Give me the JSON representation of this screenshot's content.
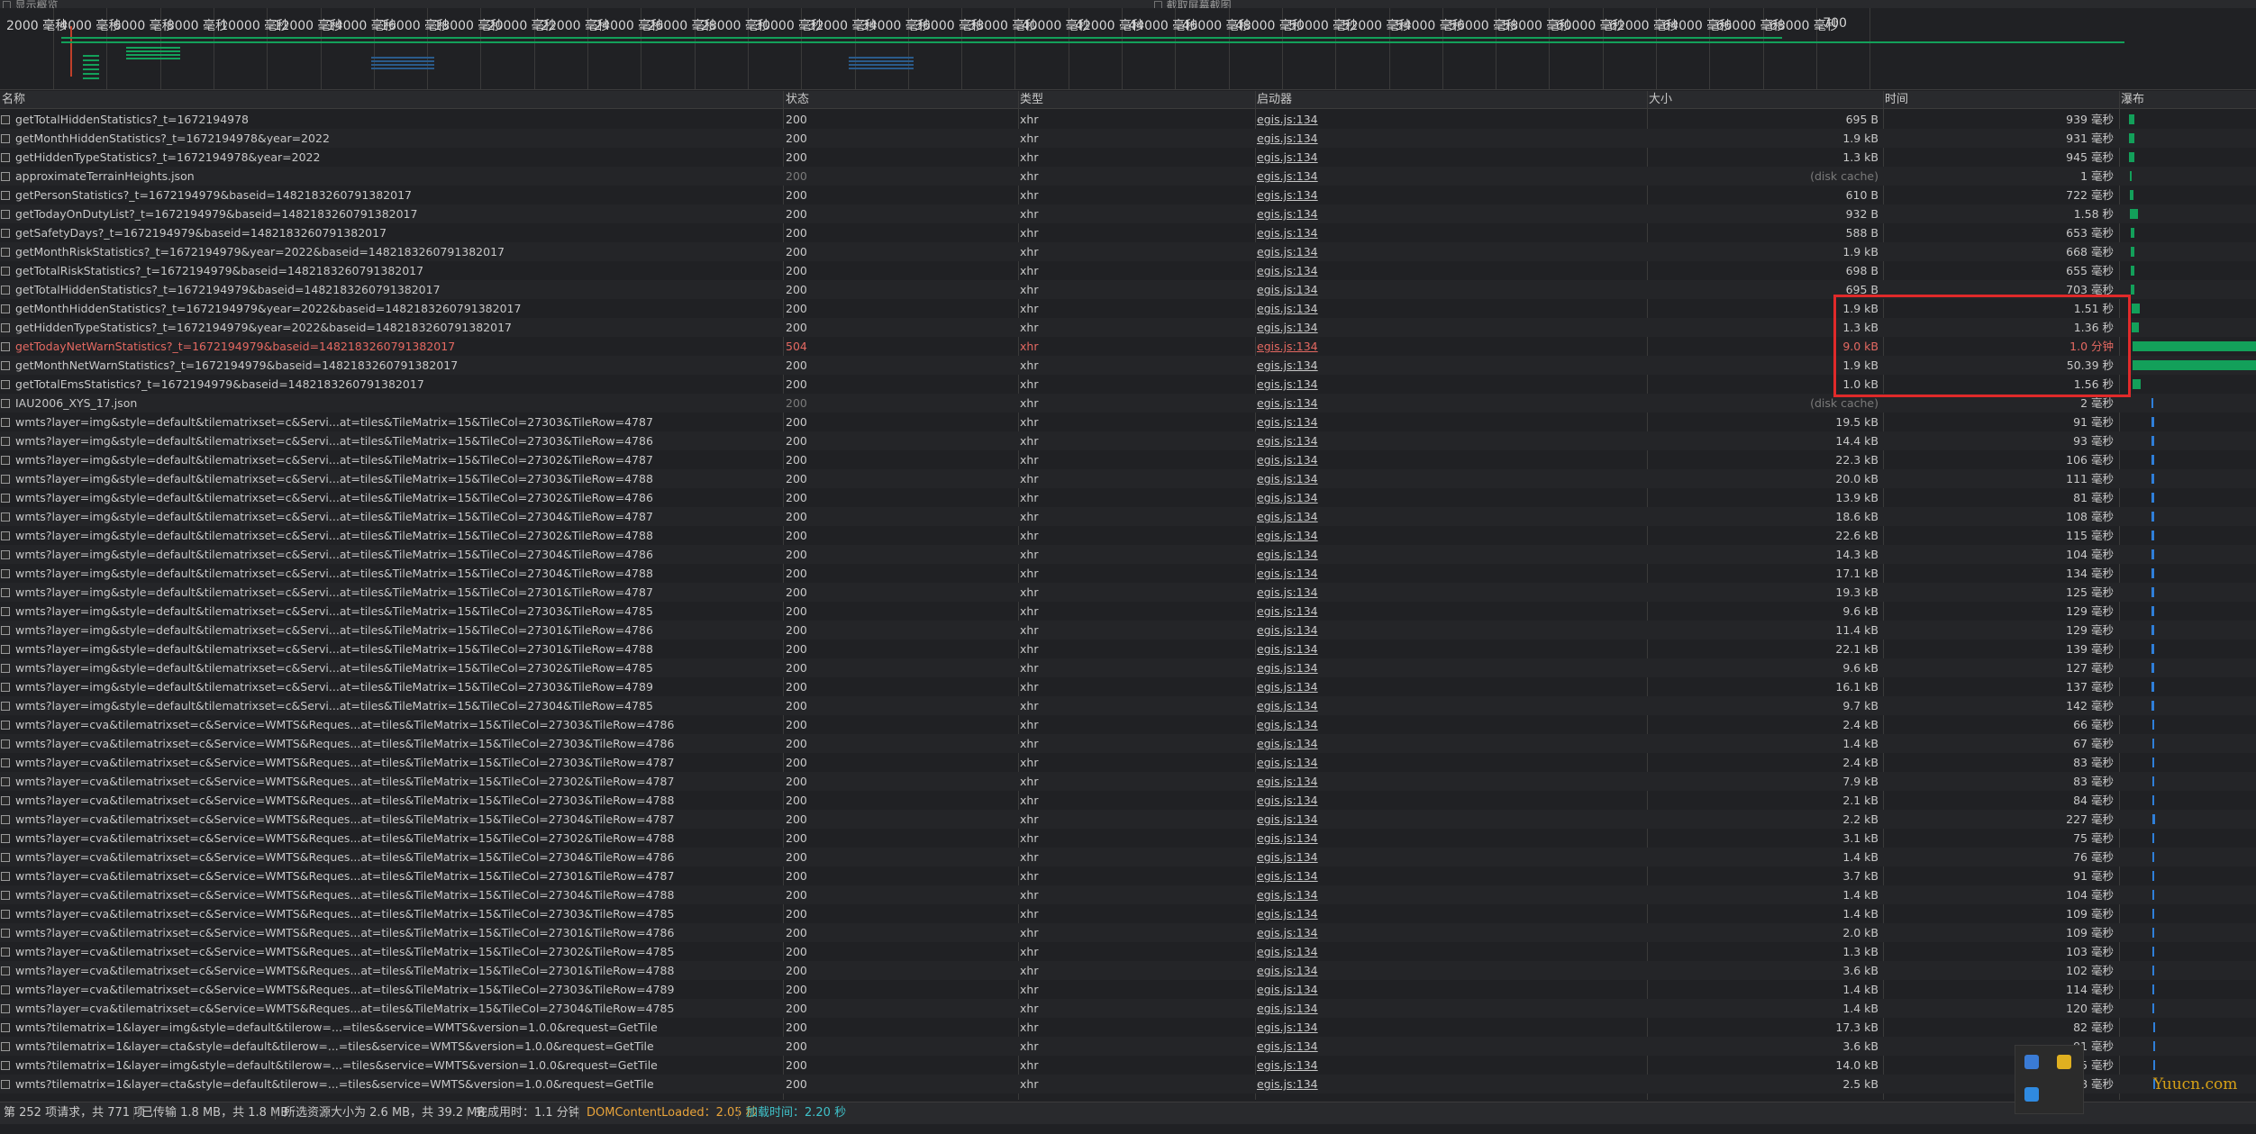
{
  "top": {
    "left_checkbox": "显示概览",
    "right_checkbox": "截取屏幕截图"
  },
  "overview": {
    "ticks": [
      "2000 毫秒",
      "4000 毫秒",
      "6000 毫秒",
      "8000 毫秒",
      "10000 毫秒",
      "12000 毫秒",
      "14000 毫秒",
      "16000 毫秒",
      "18000 毫秒",
      "20000 毫秒",
      "22000 毫秒",
      "24000 毫秒",
      "26000 毫秒",
      "28000 毫秒",
      "30000 毫秒",
      "32000 毫秒",
      "34000 毫秒",
      "36000 毫秒",
      "38000 毫秒",
      "40000 毫秒",
      "42000 毫秒",
      "44000 毫秒",
      "46000 毫秒",
      "48000 毫秒",
      "50000 毫秒",
      "52000 毫秒",
      "54000 毫秒",
      "56000 毫秒",
      "58000 毫秒",
      "60000 毫秒",
      "62000 毫秒",
      "64000 毫秒",
      "66000 毫秒",
      "68000 毫秒",
      "700"
    ]
  },
  "columns": {
    "name": "名称",
    "status": "状态",
    "type": "类型",
    "initiator": "启动器",
    "size": "大小",
    "time": "时间",
    "waterfall": "瀑布"
  },
  "rows": [
    {
      "name": "getTotalHiddenStatistics?_t=1672194978",
      "status": "200",
      "type": "xhr",
      "initiator": "egis.js:134",
      "size": "695 B",
      "time": "939 毫秒"
    },
    {
      "name": "getMonthHiddenStatistics?_t=1672194978&year=2022",
      "status": "200",
      "type": "xhr",
      "initiator": "egis.js:134",
      "size": "1.9 kB",
      "time": "931 毫秒"
    },
    {
      "name": "getHiddenTypeStatistics?_t=1672194978&year=2022",
      "status": "200",
      "type": "xhr",
      "initiator": "egis.js:134",
      "size": "1.3 kB",
      "time": "945 毫秒"
    },
    {
      "name": "approximateTerrainHeights.json",
      "status": "200",
      "type": "xhr",
      "initiator": "egis.js:134",
      "size": "(disk cache)",
      "time": "1 毫秒",
      "cache": true
    },
    {
      "name": "getPersonStatistics?_t=1672194979&baseid=1482183260791382017",
      "status": "200",
      "type": "xhr",
      "initiator": "egis.js:134",
      "size": "610 B",
      "time": "722 毫秒"
    },
    {
      "name": "getTodayOnDutyList?_t=1672194979&baseid=1482183260791382017",
      "status": "200",
      "type": "xhr",
      "initiator": "egis.js:134",
      "size": "932 B",
      "time": "1.58 秒"
    },
    {
      "name": "getSafetyDays?_t=1672194979&baseid=1482183260791382017",
      "status": "200",
      "type": "xhr",
      "initiator": "egis.js:134",
      "size": "588 B",
      "time": "653 毫秒"
    },
    {
      "name": "getMonthRiskStatistics?_t=1672194979&year=2022&baseid=1482183260791382017",
      "status": "200",
      "type": "xhr",
      "initiator": "egis.js:134",
      "size": "1.9 kB",
      "time": "668 毫秒"
    },
    {
      "name": "getTotalRiskStatistics?_t=1672194979&baseid=1482183260791382017",
      "status": "200",
      "type": "xhr",
      "initiator": "egis.js:134",
      "size": "698 B",
      "time": "655 毫秒"
    },
    {
      "name": "getTotalHiddenStatistics?_t=1672194979&baseid=1482183260791382017",
      "status": "200",
      "type": "xhr",
      "initiator": "egis.js:134",
      "size": "695 B",
      "time": "703 毫秒"
    },
    {
      "name": "getMonthHiddenStatistics?_t=1672194979&year=2022&baseid=1482183260791382017",
      "status": "200",
      "type": "xhr",
      "initiator": "egis.js:134",
      "size": "1.9 kB",
      "time": "1.51 秒"
    },
    {
      "name": "getHiddenTypeStatistics?_t=1672194979&year=2022&baseid=1482183260791382017",
      "status": "200",
      "type": "xhr",
      "initiator": "egis.js:134",
      "size": "1.3 kB",
      "time": "1.36 秒"
    },
    {
      "name": "getTodayNetWarnStatistics?_t=1672194979&baseid=1482183260791382017",
      "status": "504",
      "type": "xhr",
      "initiator": "egis.js:134",
      "size": "9.0 kB",
      "time": "1.0 分钟",
      "error": true
    },
    {
      "name": "getMonthNetWarnStatistics?_t=1672194979&baseid=1482183260791382017",
      "status": "200",
      "type": "xhr",
      "initiator": "egis.js:134",
      "size": "1.9 kB",
      "time": "50.39 秒"
    },
    {
      "name": "getTotalEmsStatistics?_t=1672194979&baseid=1482183260791382017",
      "status": "200",
      "type": "xhr",
      "initiator": "egis.js:134",
      "size": "1.0 kB",
      "time": "1.56 秒"
    },
    {
      "name": "IAU2006_XYS_17.json",
      "status": "200",
      "type": "xhr",
      "initiator": "egis.js:134",
      "size": "(disk cache)",
      "time": "2 毫秒",
      "cache": true
    },
    {
      "name": "wmts?layer=img&style=default&tilematrixset=c&Servi...at=tiles&TileMatrix=15&TileCol=27303&TileRow=4787",
      "status": "200",
      "type": "xhr",
      "initiator": "egis.js:134",
      "size": "19.5 kB",
      "time": "91 毫秒"
    },
    {
      "name": "wmts?layer=img&style=default&tilematrixset=c&Servi...at=tiles&TileMatrix=15&TileCol=27303&TileRow=4786",
      "status": "200",
      "type": "xhr",
      "initiator": "egis.js:134",
      "size": "14.4 kB",
      "time": "93 毫秒"
    },
    {
      "name": "wmts?layer=img&style=default&tilematrixset=c&Servi...at=tiles&TileMatrix=15&TileCol=27302&TileRow=4787",
      "status": "200",
      "type": "xhr",
      "initiator": "egis.js:134",
      "size": "22.3 kB",
      "time": "106 毫秒"
    },
    {
      "name": "wmts?layer=img&style=default&tilematrixset=c&Servi...at=tiles&TileMatrix=15&TileCol=27303&TileRow=4788",
      "status": "200",
      "type": "xhr",
      "initiator": "egis.js:134",
      "size": "20.0 kB",
      "time": "111 毫秒"
    },
    {
      "name": "wmts?layer=img&style=default&tilematrixset=c&Servi...at=tiles&TileMatrix=15&TileCol=27302&TileRow=4786",
      "status": "200",
      "type": "xhr",
      "initiator": "egis.js:134",
      "size": "13.9 kB",
      "time": "81 毫秒"
    },
    {
      "name": "wmts?layer=img&style=default&tilematrixset=c&Servi...at=tiles&TileMatrix=15&TileCol=27304&TileRow=4787",
      "status": "200",
      "type": "xhr",
      "initiator": "egis.js:134",
      "size": "18.6 kB",
      "time": "108 毫秒"
    },
    {
      "name": "wmts?layer=img&style=default&tilematrixset=c&Servi...at=tiles&TileMatrix=15&TileCol=27302&TileRow=4788",
      "status": "200",
      "type": "xhr",
      "initiator": "egis.js:134",
      "size": "22.6 kB",
      "time": "115 毫秒"
    },
    {
      "name": "wmts?layer=img&style=default&tilematrixset=c&Servi...at=tiles&TileMatrix=15&TileCol=27304&TileRow=4786",
      "status": "200",
      "type": "xhr",
      "initiator": "egis.js:134",
      "size": "14.3 kB",
      "time": "104 毫秒"
    },
    {
      "name": "wmts?layer=img&style=default&tilematrixset=c&Servi...at=tiles&TileMatrix=15&TileCol=27304&TileRow=4788",
      "status": "200",
      "type": "xhr",
      "initiator": "egis.js:134",
      "size": "17.1 kB",
      "time": "134 毫秒"
    },
    {
      "name": "wmts?layer=img&style=default&tilematrixset=c&Servi...at=tiles&TileMatrix=15&TileCol=27301&TileRow=4787",
      "status": "200",
      "type": "xhr",
      "initiator": "egis.js:134",
      "size": "19.3 kB",
      "time": "125 毫秒"
    },
    {
      "name": "wmts?layer=img&style=default&tilematrixset=c&Servi...at=tiles&TileMatrix=15&TileCol=27303&TileRow=4785",
      "status": "200",
      "type": "xhr",
      "initiator": "egis.js:134",
      "size": "9.6 kB",
      "time": "129 毫秒"
    },
    {
      "name": "wmts?layer=img&style=default&tilematrixset=c&Servi...at=tiles&TileMatrix=15&TileCol=27301&TileRow=4786",
      "status": "200",
      "type": "xhr",
      "initiator": "egis.js:134",
      "size": "11.4 kB",
      "time": "129 毫秒"
    },
    {
      "name": "wmts?layer=img&style=default&tilematrixset=c&Servi...at=tiles&TileMatrix=15&TileCol=27301&TileRow=4788",
      "status": "200",
      "type": "xhr",
      "initiator": "egis.js:134",
      "size": "22.1 kB",
      "time": "139 毫秒"
    },
    {
      "name": "wmts?layer=img&style=default&tilematrixset=c&Servi...at=tiles&TileMatrix=15&TileCol=27302&TileRow=4785",
      "status": "200",
      "type": "xhr",
      "initiator": "egis.js:134",
      "size": "9.6 kB",
      "time": "127 毫秒"
    },
    {
      "name": "wmts?layer=img&style=default&tilematrixset=c&Servi...at=tiles&TileMatrix=15&TileCol=27303&TileRow=4789",
      "status": "200",
      "type": "xhr",
      "initiator": "egis.js:134",
      "size": "16.1 kB",
      "time": "137 毫秒"
    },
    {
      "name": "wmts?layer=img&style=default&tilematrixset=c&Servi...at=tiles&TileMatrix=15&TileCol=27304&TileRow=4785",
      "status": "200",
      "type": "xhr",
      "initiator": "egis.js:134",
      "size": "9.7 kB",
      "time": "142 毫秒"
    },
    {
      "name": "wmts?layer=cva&tilematrixset=c&Service=WMTS&Reques...at=tiles&TileMatrix=15&TileCol=27303&TileRow=4786",
      "status": "200",
      "type": "xhr",
      "initiator": "egis.js:134",
      "size": "2.4 kB",
      "time": "66 毫秒"
    },
    {
      "name": "wmts?layer=cva&tilematrixset=c&Service=WMTS&Reques...at=tiles&TileMatrix=15&TileCol=27303&TileRow=4786",
      "status": "200",
      "type": "xhr",
      "initiator": "egis.js:134",
      "size": "1.4 kB",
      "time": "67 毫秒"
    },
    {
      "name": "wmts?layer=cva&tilematrixset=c&Service=WMTS&Reques...at=tiles&TileMatrix=15&TileCol=27303&TileRow=4787",
      "status": "200",
      "type": "xhr",
      "initiator": "egis.js:134",
      "size": "2.4 kB",
      "time": "83 毫秒"
    },
    {
      "name": "wmts?layer=cva&tilematrixset=c&Service=WMTS&Reques...at=tiles&TileMatrix=15&TileCol=27302&TileRow=4787",
      "status": "200",
      "type": "xhr",
      "initiator": "egis.js:134",
      "size": "7.9 kB",
      "time": "83 毫秒"
    },
    {
      "name": "wmts?layer=cva&tilematrixset=c&Service=WMTS&Reques...at=tiles&TileMatrix=15&TileCol=27303&TileRow=4788",
      "status": "200",
      "type": "xhr",
      "initiator": "egis.js:134",
      "size": "2.1 kB",
      "time": "84 毫秒"
    },
    {
      "name": "wmts?layer=cva&tilematrixset=c&Service=WMTS&Reques...at=tiles&TileMatrix=15&TileCol=27304&TileRow=4787",
      "status": "200",
      "type": "xhr",
      "initiator": "egis.js:134",
      "size": "2.2 kB",
      "time": "227 毫秒"
    },
    {
      "name": "wmts?layer=cva&tilematrixset=c&Service=WMTS&Reques...at=tiles&TileMatrix=15&TileCol=27302&TileRow=4788",
      "status": "200",
      "type": "xhr",
      "initiator": "egis.js:134",
      "size": "3.1 kB",
      "time": "75 毫秒"
    },
    {
      "name": "wmts?layer=cva&tilematrixset=c&Service=WMTS&Reques...at=tiles&TileMatrix=15&TileCol=27304&TileRow=4786",
      "status": "200",
      "type": "xhr",
      "initiator": "egis.js:134",
      "size": "1.4 kB",
      "time": "76 毫秒"
    },
    {
      "name": "wmts?layer=cva&tilematrixset=c&Service=WMTS&Reques...at=tiles&TileMatrix=15&TileCol=27301&TileRow=4787",
      "status": "200",
      "type": "xhr",
      "initiator": "egis.js:134",
      "size": "3.7 kB",
      "time": "91 毫秒"
    },
    {
      "name": "wmts?layer=cva&tilematrixset=c&Service=WMTS&Reques...at=tiles&TileMatrix=15&TileCol=27304&TileRow=4788",
      "status": "200",
      "type": "xhr",
      "initiator": "egis.js:134",
      "size": "1.4 kB",
      "time": "104 毫秒"
    },
    {
      "name": "wmts?layer=cva&tilematrixset=c&Service=WMTS&Reques...at=tiles&TileMatrix=15&TileCol=27303&TileRow=4785",
      "status": "200",
      "type": "xhr",
      "initiator": "egis.js:134",
      "size": "1.4 kB",
      "time": "109 毫秒"
    },
    {
      "name": "wmts?layer=cva&tilematrixset=c&Service=WMTS&Reques...at=tiles&TileMatrix=15&TileCol=27301&TileRow=4786",
      "status": "200",
      "type": "xhr",
      "initiator": "egis.js:134",
      "size": "2.0 kB",
      "time": "109 毫秒"
    },
    {
      "name": "wmts?layer=cva&tilematrixset=c&Service=WMTS&Reques...at=tiles&TileMatrix=15&TileCol=27302&TileRow=4785",
      "status": "200",
      "type": "xhr",
      "initiator": "egis.js:134",
      "size": "1.3 kB",
      "time": "103 毫秒"
    },
    {
      "name": "wmts?layer=cva&tilematrixset=c&Service=WMTS&Reques...at=tiles&TileMatrix=15&TileCol=27301&TileRow=4788",
      "status": "200",
      "type": "xhr",
      "initiator": "egis.js:134",
      "size": "3.6 kB",
      "time": "102 毫秒"
    },
    {
      "name": "wmts?layer=cva&tilematrixset=c&Service=WMTS&Reques...at=tiles&TileMatrix=15&TileCol=27303&TileRow=4789",
      "status": "200",
      "type": "xhr",
      "initiator": "egis.js:134",
      "size": "1.4 kB",
      "time": "114 毫秒"
    },
    {
      "name": "wmts?layer=cva&tilematrixset=c&Service=WMTS&Reques...at=tiles&TileMatrix=15&TileCol=27304&TileRow=4785",
      "status": "200",
      "type": "xhr",
      "initiator": "egis.js:134",
      "size": "1.4 kB",
      "time": "120 毫秒"
    },
    {
      "name": "wmts?tilematrix=1&layer=img&style=default&tilerow=...=tiles&service=WMTS&version=1.0.0&request=GetTile",
      "status": "200",
      "type": "xhr",
      "initiator": "egis.js:134",
      "size": "17.3 kB",
      "time": "82 毫秒"
    },
    {
      "name": "wmts?tilematrix=1&layer=cta&style=default&tilerow=...=tiles&service=WMTS&version=1.0.0&request=GetTile",
      "status": "200",
      "type": "xhr",
      "initiator": "egis.js:134",
      "size": "3.6 kB",
      "time": "91 毫秒"
    },
    {
      "name": "wmts?tilematrix=1&layer=img&style=default&tilerow=...=tiles&service=WMTS&version=1.0.0&request=GetTile",
      "status": "200",
      "type": "xhr",
      "initiator": "egis.js:134",
      "size": "14.0 kB",
      "time": "5 毫秒"
    },
    {
      "name": "wmts?tilematrix=1&layer=cta&style=default&tilerow=...=tiles&service=WMTS&version=1.0.0&request=GetTile",
      "status": "200",
      "type": "xhr",
      "initiator": "egis.js:134",
      "size": "2.5 kB",
      "time": "8 毫秒"
    }
  ],
  "statusbar": {
    "requests": "第 252 项请求，共 771 项",
    "transferred": "已传输 1.8 MB，共 1.8 MB",
    "resources": "所选资源大小为 2.6 MB，共 39.2 MB",
    "finish": "完成用时：1.1 分钟",
    "dcl": "DOMContentLoaded：2.05 秒",
    "load": "加载时间：2.20 秒"
  },
  "watermark": "Yuucn.com",
  "colors": {
    "accent_red": "#e02a2a",
    "error_text": "#e46962",
    "waterfall_green": "#13a05a",
    "dcl_orange": "#e8a33a",
    "load_cyan": "#3fc1c9"
  }
}
